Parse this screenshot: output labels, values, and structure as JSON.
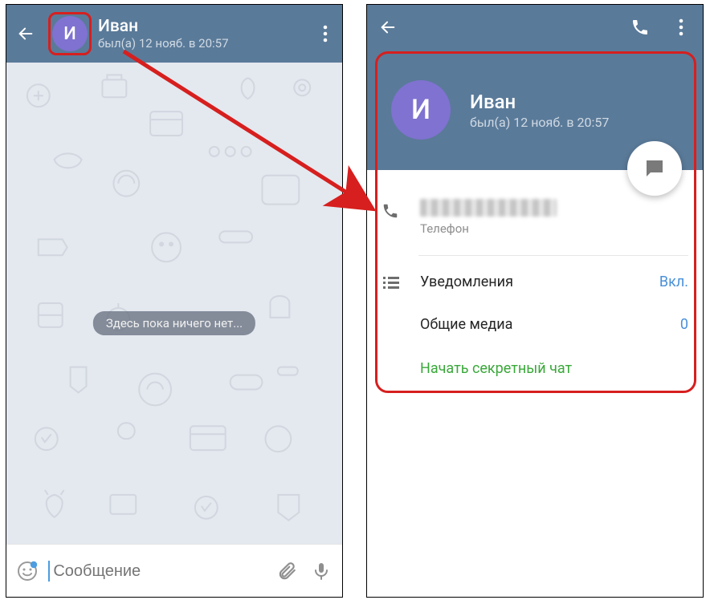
{
  "chat": {
    "avatar_initial": "И",
    "name": "Иван",
    "status": "был(а) 12 нояб. в 20:57",
    "empty_text": "Здесь пока ничего нет...",
    "input_placeholder": "Сообщение"
  },
  "profile": {
    "avatar_initial": "И",
    "name": "Иван",
    "status": "был(а) 12 нояб. в 20:57",
    "phone_label": "Телефон",
    "notifications_label": "Уведомления",
    "notifications_value": "Вкл.",
    "media_label": "Общие медиа",
    "media_value": "0",
    "secret_chat": "Начать секретный чат"
  }
}
